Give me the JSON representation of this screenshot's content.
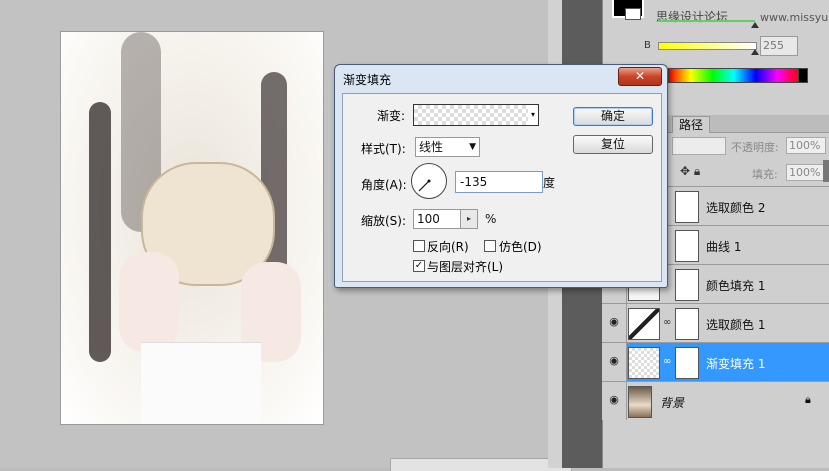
{
  "toolbar_right": {
    "watermark": "思缘设计论坛",
    "watermark_url": "www.missyuan.com",
    "color_b_label": "B",
    "color_b_value": "255",
    "colors": {
      "spectrum_end": "#000000",
      "b_slider_start": "#ffff00"
    }
  },
  "layers_panel": {
    "tab_paths": "路径",
    "opacity_label": "不透明度:",
    "opacity_value": "100%",
    "fill_label": "填充:",
    "fill_value": "100%",
    "layers": [
      {
        "name": "选取颜色 2",
        "visible": false,
        "selected": false
      },
      {
        "name": "曲线 1",
        "visible": false,
        "selected": false
      },
      {
        "name": "颜色填充 1",
        "visible": false,
        "selected": false
      },
      {
        "name": "选取颜色 1",
        "visible": true,
        "selected": false
      },
      {
        "name": "渐变填充 1",
        "visible": true,
        "selected": true
      },
      {
        "name": "背景",
        "visible": true,
        "selected": false,
        "locked": true
      }
    ],
    "selected_color": "#3399ff"
  },
  "dialog": {
    "title": "渐变填充",
    "gradient_label": "渐变:",
    "style_label": "样式(T):",
    "style_value": "线性",
    "angle_label": "角度(A):",
    "angle_value": "-135",
    "angle_unit": "度",
    "scale_label": "缩放(S):",
    "scale_value": "100",
    "scale_unit": "%",
    "reverse_label": "反向(R)",
    "reverse_checked": false,
    "dither_label": "仿色(D)",
    "dither_checked": false,
    "align_label": "与图层对齐(L)",
    "align_checked": true,
    "ok_label": "确定",
    "reset_label": "复位",
    "close_glyph": "✕"
  }
}
